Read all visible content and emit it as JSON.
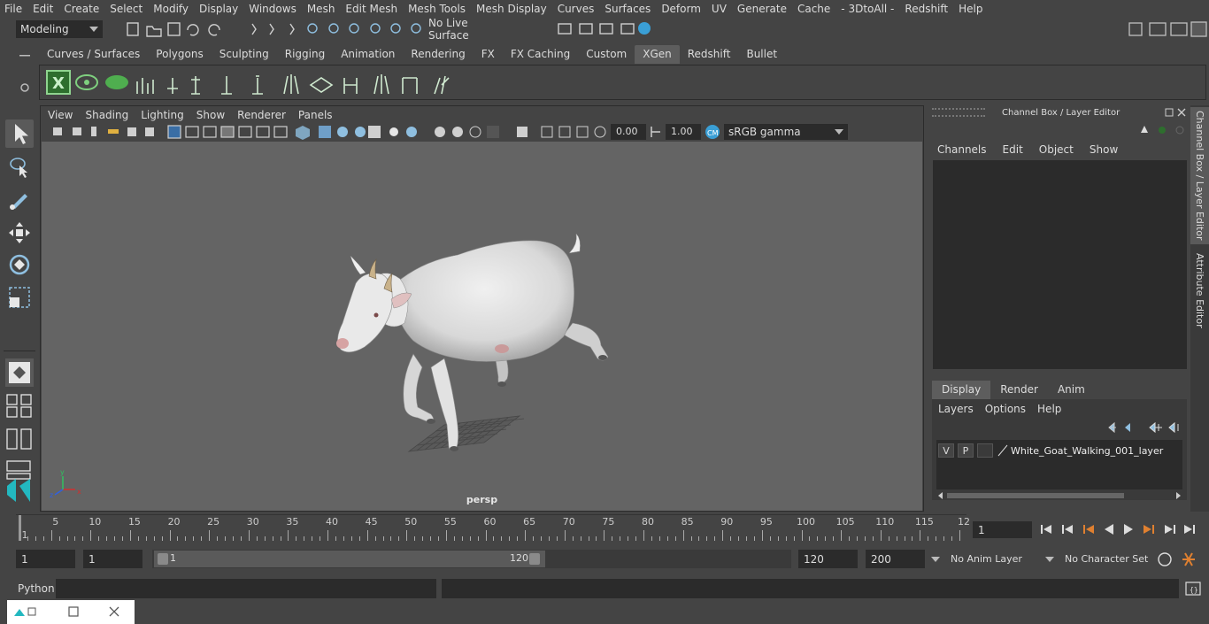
{
  "menubar": {
    "items": [
      "File",
      "Edit",
      "Create",
      "Select",
      "Modify",
      "Display",
      "Windows",
      "Mesh",
      "Edit Mesh",
      "Mesh Tools",
      "Mesh Display",
      "Curves",
      "Surfaces",
      "Deform",
      "UV",
      "Generate",
      "Cache",
      "- 3DtoAll -",
      "Redshift",
      "Help"
    ]
  },
  "status_line": {
    "mode_dropdown": "Modeling",
    "live_surface": "No Live Surface"
  },
  "shelf": {
    "tabs": [
      "Curves / Surfaces",
      "Polygons",
      "Sculpting",
      "Rigging",
      "Animation",
      "Rendering",
      "FX",
      "FX Caching",
      "Custom",
      "XGen",
      "Redshift",
      "Bullet"
    ],
    "active_tab": "XGen"
  },
  "viewport": {
    "menu": [
      "View",
      "Shading",
      "Lighting",
      "Show",
      "Renderer",
      "Panels"
    ],
    "exposure": "0.00",
    "gamma": "1.00",
    "color_space": "sRGB gamma",
    "camera_label": "persp"
  },
  "channel_box": {
    "title": "Channel Box / Layer Editor",
    "menu": [
      "Channels",
      "Edit",
      "Object",
      "Show"
    ],
    "layer_tabs": [
      "Display",
      "Render",
      "Anim"
    ],
    "active_layer_tab": "Display",
    "layer_menu": [
      "Layers",
      "Options",
      "Help"
    ],
    "layer": {
      "v": "V",
      "p": "P",
      "name": "White_Goat_Walking_001_layer"
    }
  },
  "side_tabs": {
    "channel_box": "Channel Box / Layer Editor",
    "attribute_editor": "Attribute Editor"
  },
  "timeline": {
    "start_label": "1",
    "labels": [
      "5",
      "10",
      "15",
      "20",
      "25",
      "30",
      "35",
      "40",
      "45",
      "50",
      "55",
      "60",
      "65",
      "70",
      "75",
      "80",
      "85",
      "90",
      "95",
      "100",
      "105",
      "110",
      "115",
      "12"
    ],
    "current_frame": "1"
  },
  "range": {
    "start": "1",
    "playback_start": "1",
    "slider_start": "1",
    "slider_end": "120",
    "playback_end": "120",
    "end": "200",
    "anim_layer": "No Anim Layer",
    "character_set": "No Character Set"
  },
  "command_line": {
    "label": "Python"
  },
  "colors": {
    "accent_blue": "#3a9fd6",
    "active_tab": "#5d5d5d",
    "field_bg": "#2b2b2b",
    "viewport_bg": "#646464"
  }
}
